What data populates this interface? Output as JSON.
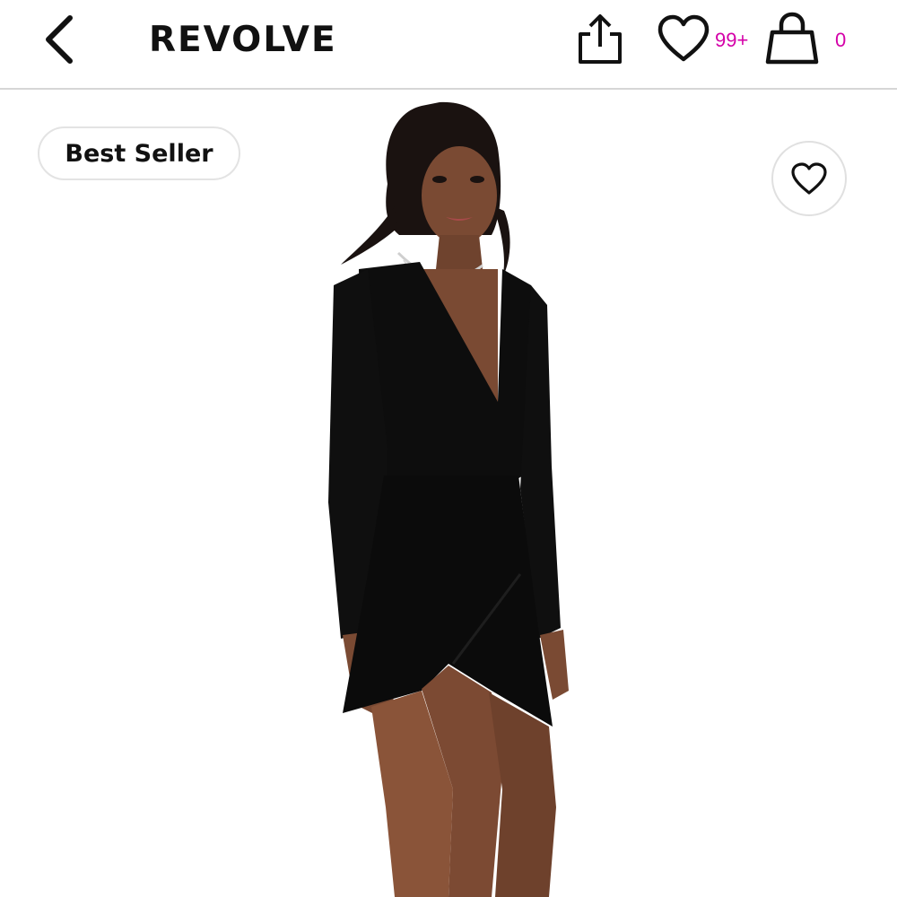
{
  "header": {
    "logo_text": "REVOLVE",
    "wishlist_count": "99+",
    "bag_count": "0",
    "accent_color": "#d400a8"
  },
  "icons": {
    "back": "chevron-left-icon",
    "share": "share-icon",
    "wishlist": "heart-icon",
    "bag": "shopping-bag-icon",
    "favorite": "heart-outline-icon"
  },
  "product_image": {
    "badge_label": "Best Seller"
  }
}
